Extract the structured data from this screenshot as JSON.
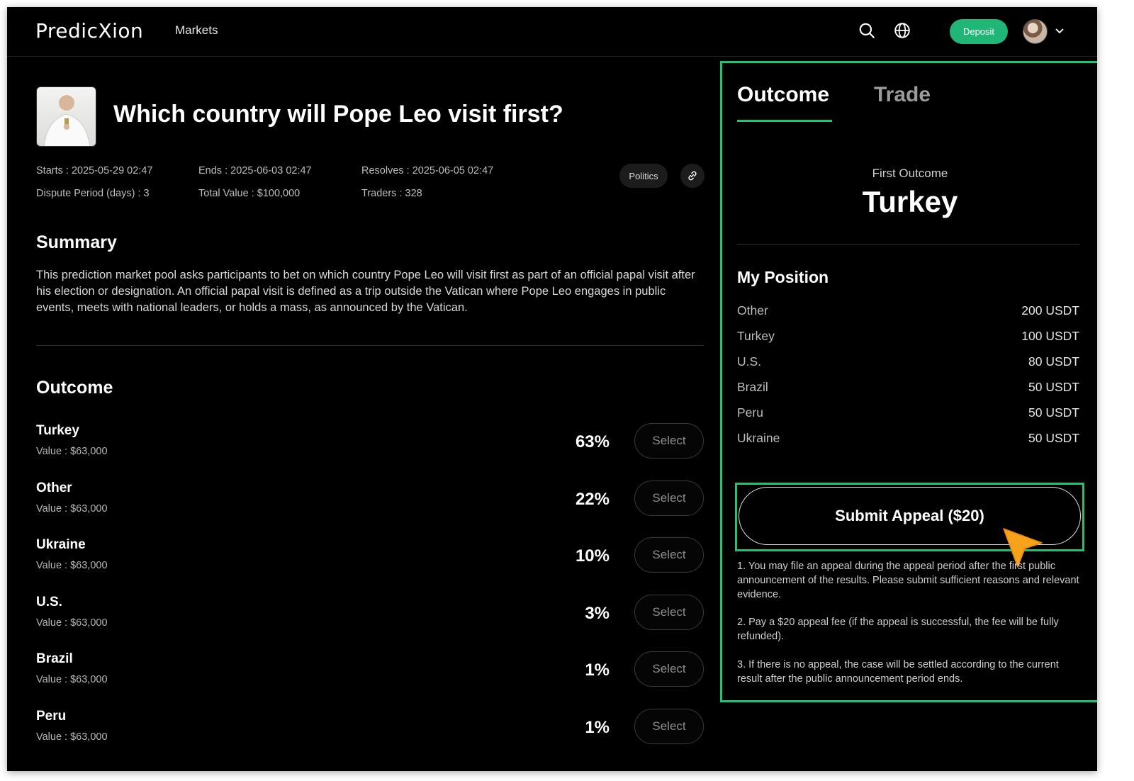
{
  "header": {
    "logo_text": "PredicXion",
    "nav_markets": "Markets",
    "deposit_label": "Deposit",
    "icons": [
      "search-icon",
      "globe-icon",
      "chevron-down-icon"
    ],
    "accent": "#20b677"
  },
  "market": {
    "title": "Which country will Pope Leo visit first?",
    "starts": "Starts : 2025-05-29  02:47",
    "ends": "Ends : 2025-06-03  02:47",
    "resolves": "Resolves : 2025-06-05  02:47",
    "dispute": "Dispute Period (days) : 3",
    "total_value": "Total Value : $100,000",
    "traders": "Traders : 328",
    "tag": "Politics"
  },
  "summary": {
    "heading": "Summary",
    "text": "This prediction market pool asks participants to bet on which country Pope Leo will visit first as part of an official papal visit after his election or designation. An official papal visit is defined as a trip outside the Vatican where Pope Leo engages in public events, meets with national leaders, or holds a mass, as announced by the Vatican."
  },
  "outcomes": {
    "heading": "Outcome",
    "select_label": "Select",
    "rows": [
      {
        "name": "Turkey",
        "value": "Value : $63,000",
        "pct": "63%"
      },
      {
        "name": "Other",
        "value": "Value : $63,000",
        "pct": "22%"
      },
      {
        "name": "Ukraine",
        "value": "Value : $63,000",
        "pct": "10%"
      },
      {
        "name": "U.S.",
        "value": "Value : $63,000",
        "pct": "3%"
      },
      {
        "name": "Brazil",
        "value": "Value : $63,000",
        "pct": "1%"
      },
      {
        "name": "Peru",
        "value": "Value : $63,000",
        "pct": "1%"
      }
    ]
  },
  "panel": {
    "tab_outcome": "Outcome",
    "tab_trade": "Trade",
    "first_outcome_label": "First Outcome",
    "first_outcome_value": "Turkey",
    "position_heading": "My Position",
    "positions": [
      {
        "name": "Other",
        "amount": "200 USDT"
      },
      {
        "name": "Turkey",
        "amount": "100 USDT"
      },
      {
        "name": "U.S.",
        "amount": "80 USDT"
      },
      {
        "name": "Brazil",
        "amount": "50 USDT"
      },
      {
        "name": "Peru",
        "amount": "50 USDT"
      },
      {
        "name": "Ukraine",
        "amount": "50 USDT"
      }
    ],
    "appeal_button": "Submit Appeal ($20)",
    "notes": [
      "1. You may file an appeal during the appeal period after the first public announcement of the results. Please submit sufficient reasons and relevant evidence.",
      "2. Pay a $20 appeal fee (if the appeal is successful, the fee will be fully refunded).",
      "3. If there is no appeal, the case will be settled according to the current result after the public announcement period ends."
    ],
    "highlight_color": "#1fc373",
    "cursor_color": "#f7a21b"
  }
}
